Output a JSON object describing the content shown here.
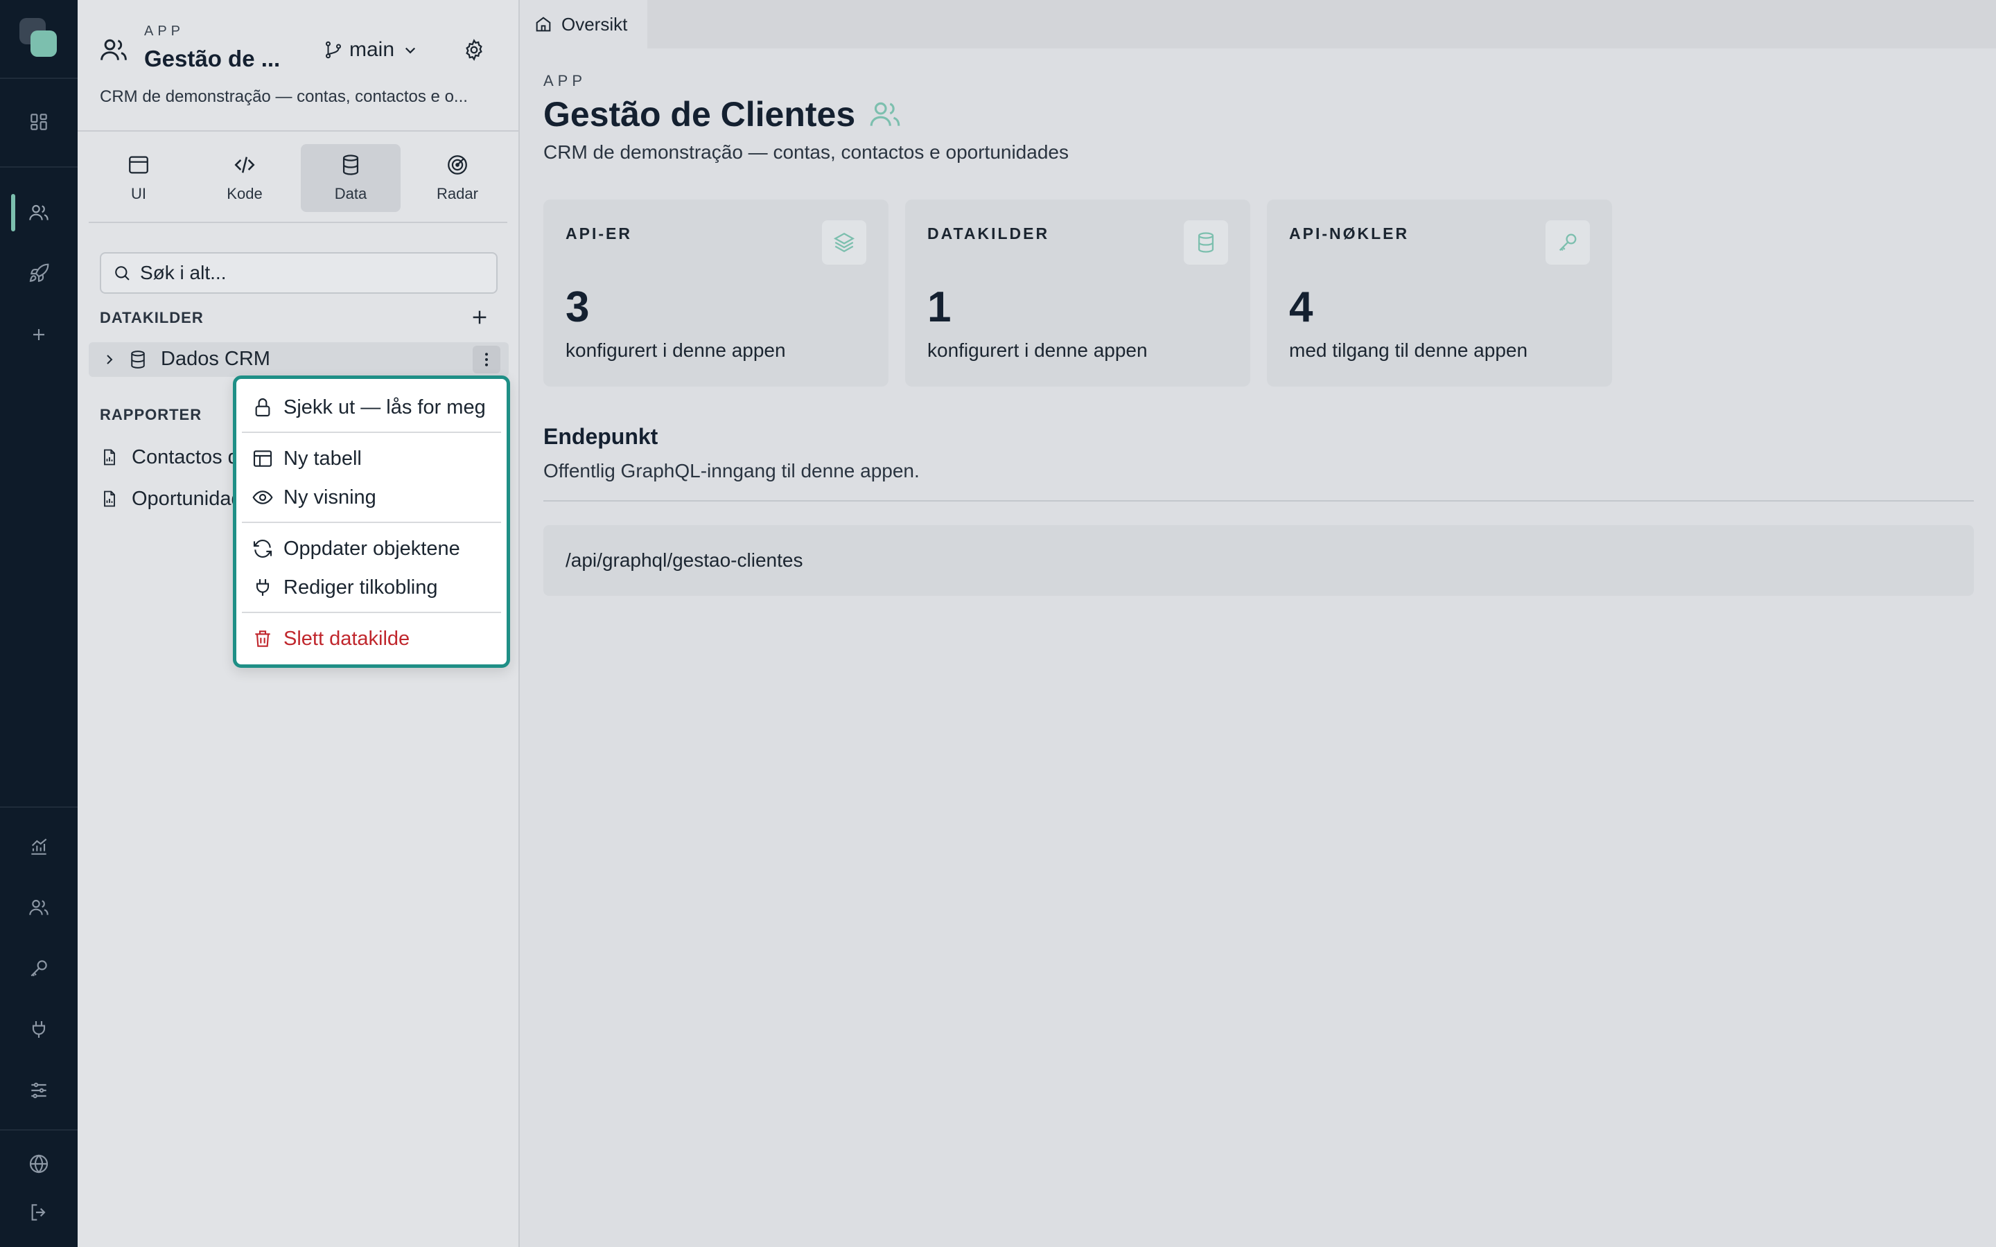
{
  "rail": {
    "top_icons": [
      "dashboard-icon",
      "users-icon",
      "rocket-icon",
      "plus-icon"
    ],
    "bottom_icons": [
      "analytics-icon",
      "team-icon",
      "key-icon",
      "plug-icon",
      "sliders-icon",
      "globe-icon",
      "logout-icon"
    ]
  },
  "sidebar": {
    "kicker": "APP",
    "title": "Gestão de ...",
    "branch": "main",
    "description": "CRM de demonstração — contas, contactos e o...",
    "tabs": [
      {
        "label": "UI",
        "icon": "window-icon"
      },
      {
        "label": "Kode",
        "icon": "code-icon"
      },
      {
        "label": "Data",
        "icon": "database-icon",
        "active": true
      },
      {
        "label": "Radar",
        "icon": "radar-icon"
      }
    ],
    "search_placeholder": "Søk i alt...",
    "datasources_label": "DATAKILDER",
    "datasource_name": "Dados CRM",
    "reports_label": "RAPPORTER",
    "reports": [
      "Contactos d",
      "Oportunidad"
    ]
  },
  "menu": {
    "items": [
      {
        "label": "Sjekk ut — lås for meg",
        "icon": "lock-icon"
      },
      {
        "label": "Ny tabell",
        "icon": "table-icon"
      },
      {
        "label": "Ny visning",
        "icon": "eye-icon"
      },
      {
        "label": "Oppdater objektene",
        "icon": "refresh-icon"
      },
      {
        "label": "Rediger tilkobling",
        "icon": "plug-icon"
      },
      {
        "label": "Slett datakilde",
        "icon": "trash-icon",
        "danger": true
      }
    ]
  },
  "main": {
    "tab_label": "Oversikt",
    "kicker": "APP",
    "title": "Gestão de Clientes",
    "description": "CRM de demonstração — contas, contactos e oportunidades",
    "cards": [
      {
        "label": "API-ER",
        "value": "3",
        "sub": "konfigurert i denne appen",
        "icon": "layers-icon"
      },
      {
        "label": "DATAKILDER",
        "value": "1",
        "sub": "konfigurert i denne appen",
        "icon": "database-icon"
      },
      {
        "label": "API-NØKLER",
        "value": "4",
        "sub": "med tilgang til denne appen",
        "icon": "key-icon"
      }
    ],
    "endpoint_title": "Endepunkt",
    "endpoint_sub": "Offentlig GraphQL-inngang til denne appen.",
    "endpoint_path": "/api/graphql/gestao-clientes"
  },
  "colors": {
    "accent": "#1f8f86",
    "rail_bg": "#0e1b29",
    "danger": "#c0272d"
  }
}
